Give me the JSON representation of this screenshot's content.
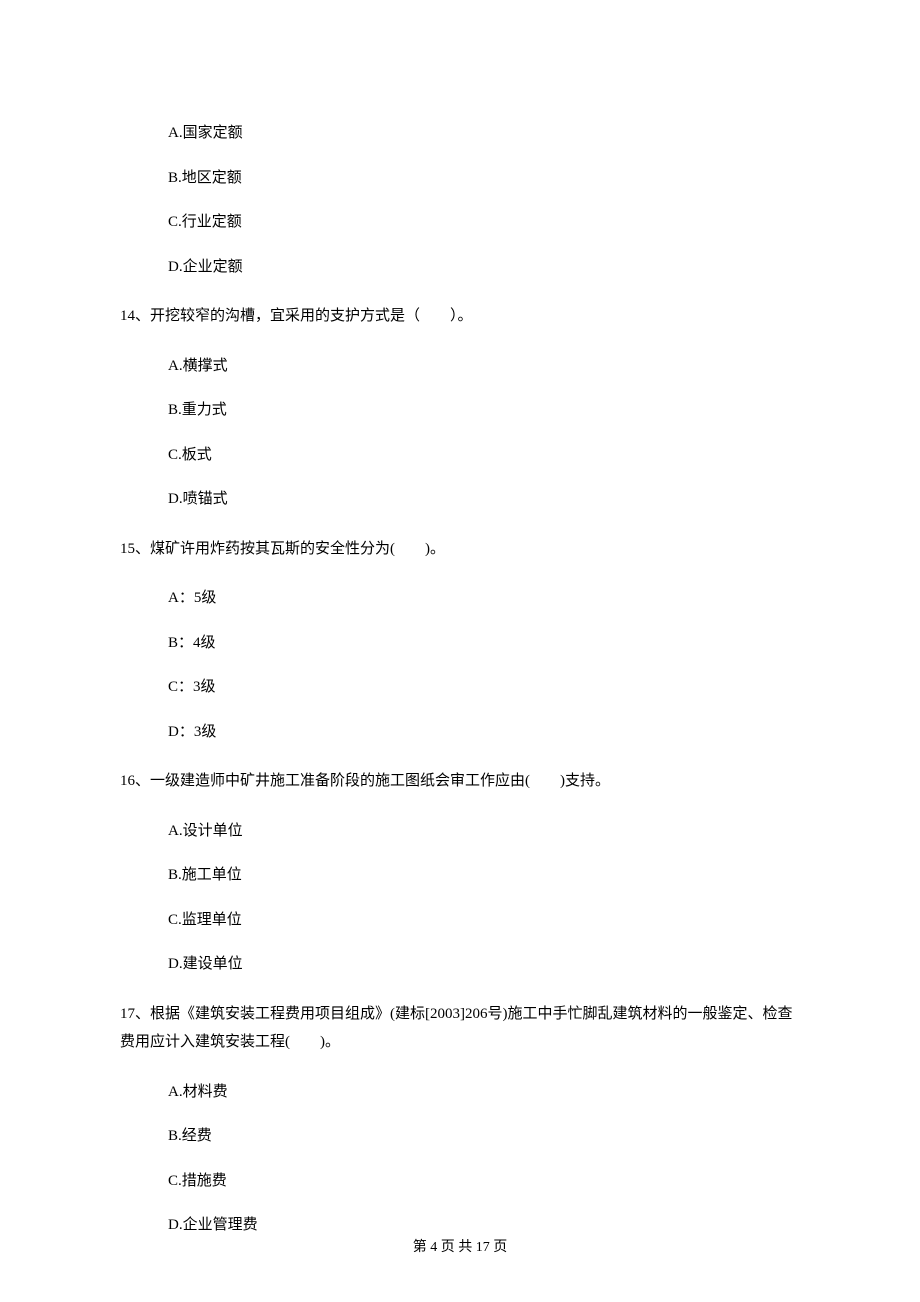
{
  "q13": {
    "options": {
      "A": "A.国家定额",
      "B": "B.地区定额",
      "C": "C.行业定额",
      "D": "D.企业定额"
    }
  },
  "q14": {
    "text": "14、开挖较窄的沟槽，宜采用的支护方式是（　　）。",
    "options": {
      "A": "A.横撑式",
      "B": "B.重力式",
      "C": "C.板式",
      "D": "D.喷锚式"
    }
  },
  "q15": {
    "text": "15、煤矿许用炸药按其瓦斯的安全性分为(　　)。",
    "options": {
      "A": "A：5级",
      "B": "B：4级",
      "C": "C：3级",
      "D": "D：3级"
    }
  },
  "q16": {
    "text": "16、一级建造师中矿井施工准备阶段的施工图纸会审工作应由(　　)支持。",
    "options": {
      "A": "A.设计单位",
      "B": "B.施工单位",
      "C": "C.监理单位",
      "D": "D.建设单位"
    }
  },
  "q17": {
    "text": "17、根据《建筑安装工程费用项目组成》(建标[2003]206号)施工中手忙脚乱建筑材料的一般鉴定、检查费用应计入建筑安装工程(　　)。",
    "options": {
      "A": "A.材料费",
      "B": "B.经费",
      "C": "C.措施费",
      "D": "D.企业管理费"
    }
  },
  "footer": "第 4 页 共 17 页"
}
